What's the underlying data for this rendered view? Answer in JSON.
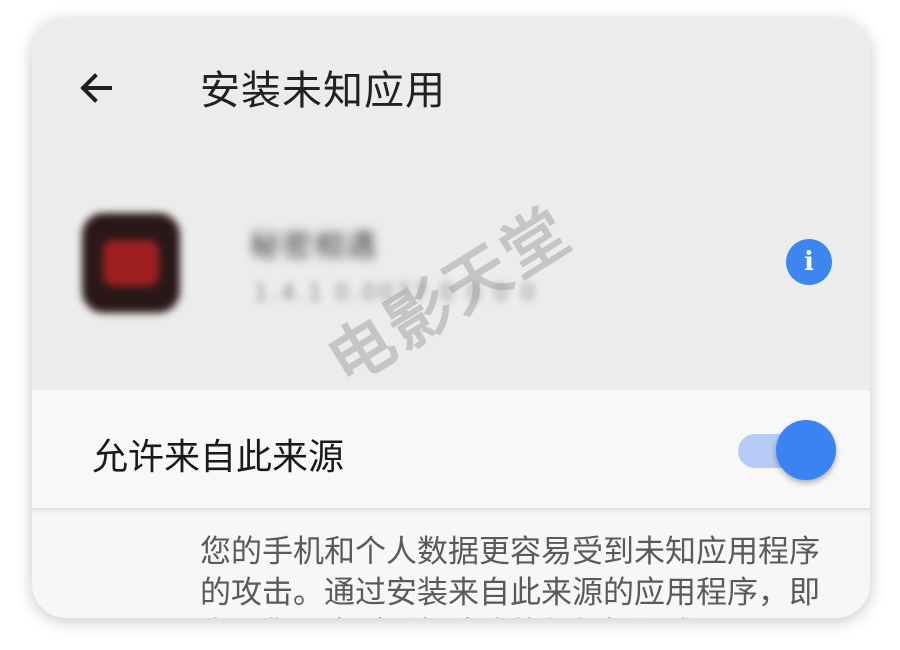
{
  "header": {
    "back_icon": "arrow-left-icon",
    "title": "安装未知应用"
  },
  "app": {
    "icon": "app-icon",
    "name": "秘密相遇",
    "version": "1.4.1 0.0077.0 0 0 0",
    "info_icon": "info-icon",
    "info_symbol": "i",
    "accent_color": "#3d86f0"
  },
  "setting": {
    "label": "允许来自此来源",
    "toggle_on": true,
    "toggle_color": "#3b82f2"
  },
  "description": {
    "text": "您的手机和个人数据更容易受到未知应用程序的攻击。通过安装来自此来源的应用程序，即表明您同意对手机造成的任何损坏或"
  },
  "watermark": {
    "text": "电影天堂"
  }
}
